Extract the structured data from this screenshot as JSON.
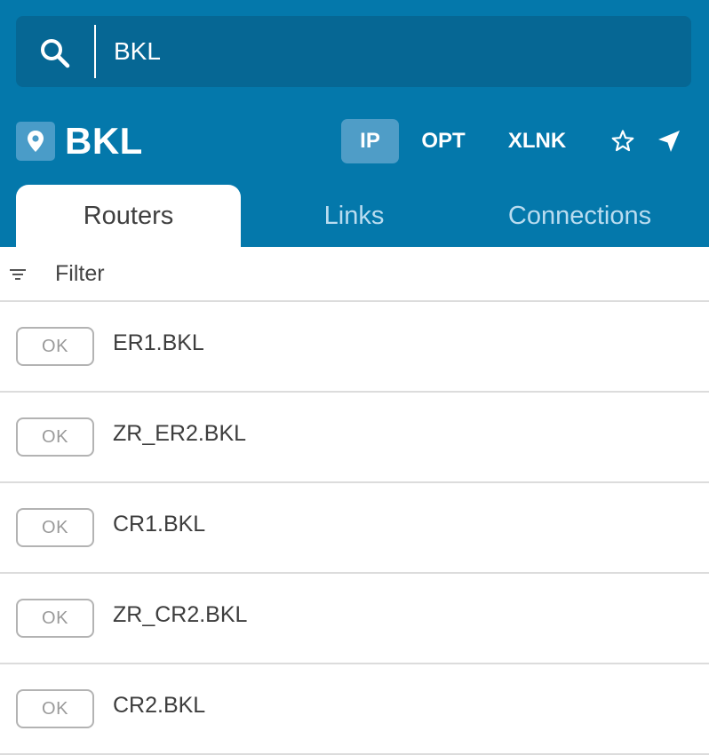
{
  "search": {
    "value": "BKL",
    "placeholder": ""
  },
  "location": {
    "title": "BKL"
  },
  "layers": {
    "ip": "IP",
    "opt": "OPT",
    "xlnk": "XLNK"
  },
  "tabs": [
    {
      "label": "Routers",
      "active": true
    },
    {
      "label": "Links",
      "active": false
    },
    {
      "label": "Connections",
      "active": false
    }
  ],
  "filter": {
    "label": "Filter"
  },
  "routers": [
    {
      "status": "OK",
      "name": "ER1.BKL"
    },
    {
      "status": "OK",
      "name": "ZR_ER2.BKL"
    },
    {
      "status": "OK",
      "name": "CR1.BKL"
    },
    {
      "status": "OK",
      "name": "ZR_CR2.BKL"
    },
    {
      "status": "OK",
      "name": "CR2.BKL"
    }
  ],
  "colors": {
    "header_bg": "#0478ab",
    "search_bg": "#066794",
    "active_layer_bg": "#4f9dc7",
    "inactive_tab_text": "#b9dcf0"
  }
}
